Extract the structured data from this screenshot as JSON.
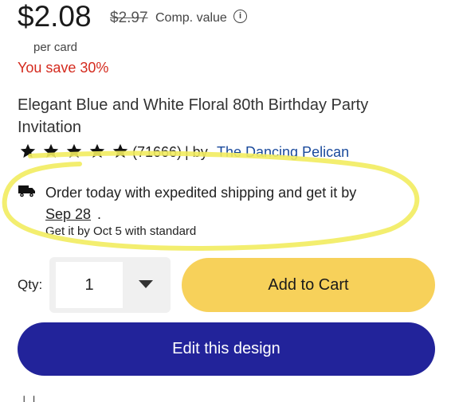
{
  "pricing": {
    "price": "$2.08",
    "comp_price": "$2.97",
    "comp_label": "Comp. value",
    "info_icon": "info-icon",
    "per_card": "per card",
    "savings": "You save 30%"
  },
  "product": {
    "title": "Elegant Blue and White Floral 80th Birthday Party Invitation",
    "rating_stars": 5,
    "review_count": "(71666)",
    "by_label": "| by",
    "seller": "The Dancing Pelican"
  },
  "shipping": {
    "icon": "truck-icon",
    "line1": "Order today with expedited shipping and get it by",
    "expedited_date": "Sep 28",
    "period": ".",
    "line2": "Get it by Oct 5 with standard"
  },
  "purchase": {
    "qty_label": "Qty:",
    "qty_value": "1",
    "add_to_cart": "Add to Cart",
    "edit_design": "Edit this design"
  },
  "colors": {
    "savings_red": "#d42a1e",
    "seller_link": "#1a4a9c",
    "cart_yellow": "#f7d15a",
    "edit_blue": "#22239a",
    "highlight_yellow": "#f2ec5f"
  }
}
